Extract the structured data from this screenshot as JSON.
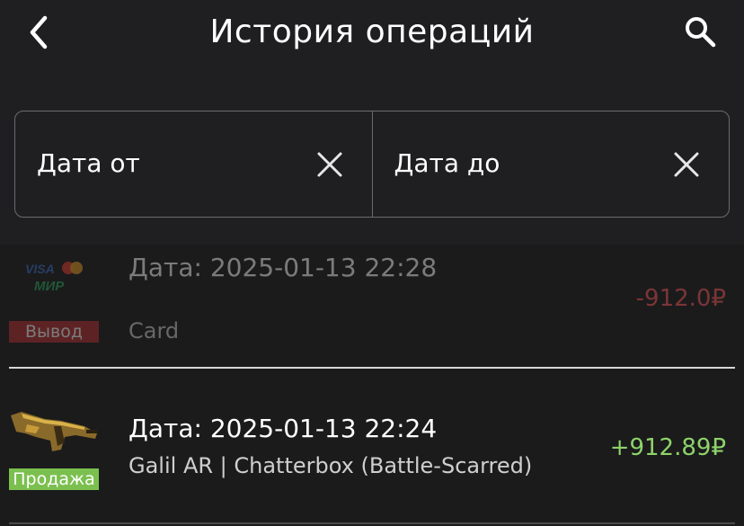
{
  "header": {
    "title": "История операций",
    "back_icon": "chevron-left-icon",
    "search_icon": "search-icon"
  },
  "date_filter": {
    "from_label": "Дата от",
    "to_label": "Дата до",
    "clear_icon": "close-icon"
  },
  "operations": [
    {
      "date": "Дата: 2025-01-13 22:28",
      "description": "Card",
      "amount": "-912.0₽",
      "type_badge": "Вывод",
      "type_color": "#b82f2f",
      "amount_color": "#ff5a5a",
      "icon": "payment-cards-icon",
      "card_brands": {
        "top": "VISA",
        "bottom": "МИР"
      }
    },
    {
      "date": "Дата: 2025-01-13 22:24",
      "description": "Galil AR | Chatterbox (Battle-Scarred)",
      "amount": "+912.89₽",
      "type_badge": "Продажа",
      "type_color": "#7bc04f",
      "amount_color": "#8ed36a",
      "icon": "rifle-skin-icon"
    }
  ]
}
